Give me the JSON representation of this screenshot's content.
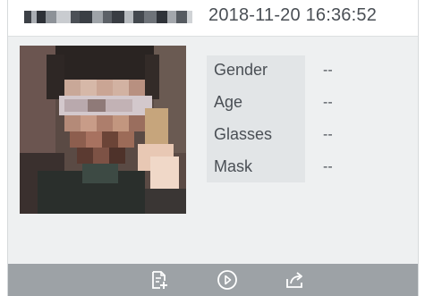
{
  "header": {
    "timestamp": "2018-11-20 16:36:52"
  },
  "attributes": [
    {
      "label": "Gender",
      "value": "--"
    },
    {
      "label": "Age",
      "value": "--"
    },
    {
      "label": "Glasses",
      "value": "--"
    },
    {
      "label": "Mask",
      "value": "--"
    }
  ],
  "footer": {
    "buttons": [
      {
        "icon": "add-document-icon"
      },
      {
        "icon": "play-circle-icon"
      },
      {
        "icon": "share-export-icon"
      }
    ]
  },
  "colors": {
    "card_background": "#eef0f1",
    "attribute_panel": "#e2e5e7",
    "footer_bar": "#9da2a6",
    "text": "#4a4f55"
  }
}
